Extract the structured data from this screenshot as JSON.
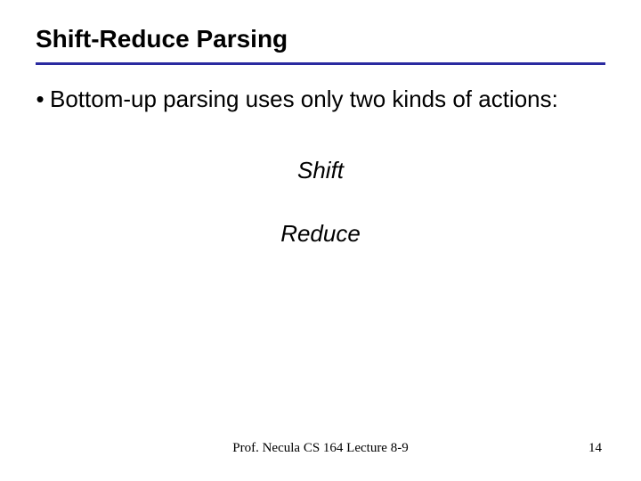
{
  "title": "Shift-Reduce Parsing",
  "bullet": "Bottom-up parsing uses only two kinds of actions:",
  "actions": {
    "a1": "Shift",
    "a2": "Reduce"
  },
  "footer": {
    "center": "Prof. Necula  CS 164  Lecture 8-9",
    "page": "14"
  }
}
